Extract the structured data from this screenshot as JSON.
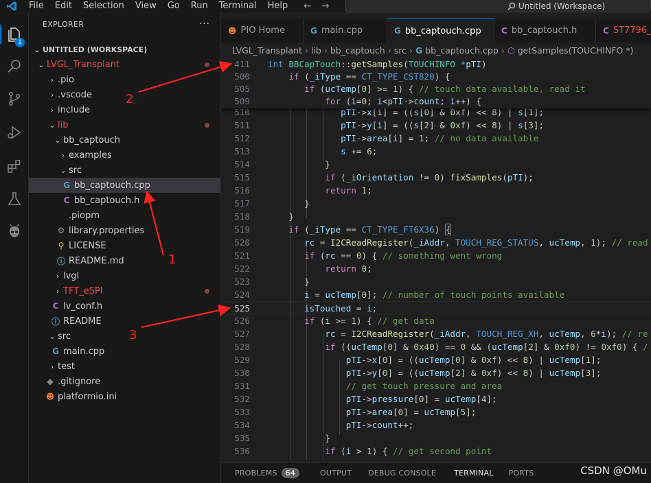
{
  "titlebar": {
    "menu": [
      "File",
      "Edit",
      "Selection",
      "View",
      "Go",
      "Run",
      "Terminal",
      "Help"
    ],
    "search_text": "Untitled (Workspace)"
  },
  "activity": {
    "badge": "1"
  },
  "sidebar": {
    "title": "EXPLORER",
    "more": "···",
    "workspace": "UNTITLED (WORKSPACE)",
    "items": [
      {
        "label": "LVGL_Transplant"
      },
      {
        "label": ".pio"
      },
      {
        "label": ".vscode"
      },
      {
        "label": "include"
      },
      {
        "label": "lib"
      },
      {
        "label": "bb_captouch"
      },
      {
        "label": "examples"
      },
      {
        "label": "src"
      },
      {
        "label": "bb_captouch.cpp"
      },
      {
        "label": "bb_captouch.h"
      },
      {
        "label": ".piopm"
      },
      {
        "label": "library.properties"
      },
      {
        "label": "LICENSE"
      },
      {
        "label": "README.md"
      },
      {
        "label": "lvgl"
      },
      {
        "label": "TFT_eSPI"
      },
      {
        "label": "lv_conf.h"
      },
      {
        "label": "README"
      },
      {
        "label": "src"
      },
      {
        "label": "main.cpp"
      },
      {
        "label": "test"
      },
      {
        "label": ".gitignore"
      },
      {
        "label": "platformio.ini"
      }
    ]
  },
  "tabs": [
    {
      "label": "PIO Home"
    },
    {
      "label": "main.cpp"
    },
    {
      "label": "bb_captouch.cpp"
    },
    {
      "label": "bb_captouch.h"
    },
    {
      "label": "ST7796_I"
    }
  ],
  "breadcrumb": [
    "LVGL_Transplant",
    "lib",
    "bb_captouch",
    "src",
    "bb_captouch.cpp",
    "getSamples(TOUCHINFO *)"
  ],
  "editor": {
    "sticky_lines": [
      "411",
      "500",
      "505",
      "509"
    ],
    "lines": [
      "510",
      "511",
      "512",
      "513",
      "514",
      "515",
      "516",
      "517",
      "518",
      "519",
      "520",
      "521",
      "522",
      "523",
      "524",
      "525",
      "526",
      "527",
      "528",
      "529",
      "530",
      "531",
      "532",
      "533",
      "534",
      "535",
      "536"
    ],
    "current_line": "525"
  },
  "panel": {
    "tabs": [
      "PROBLEMS",
      "OUTPUT",
      "DEBUG CONSOLE",
      "TERMINAL",
      "PORTS"
    ],
    "problems_count": "64",
    "active": "TERMINAL"
  },
  "annotations": [
    "1",
    "2",
    "3"
  ],
  "watermark": "CSDN @OMu",
  "colors": {
    "accent": "#0078d4",
    "arrow": "#ff2020"
  }
}
